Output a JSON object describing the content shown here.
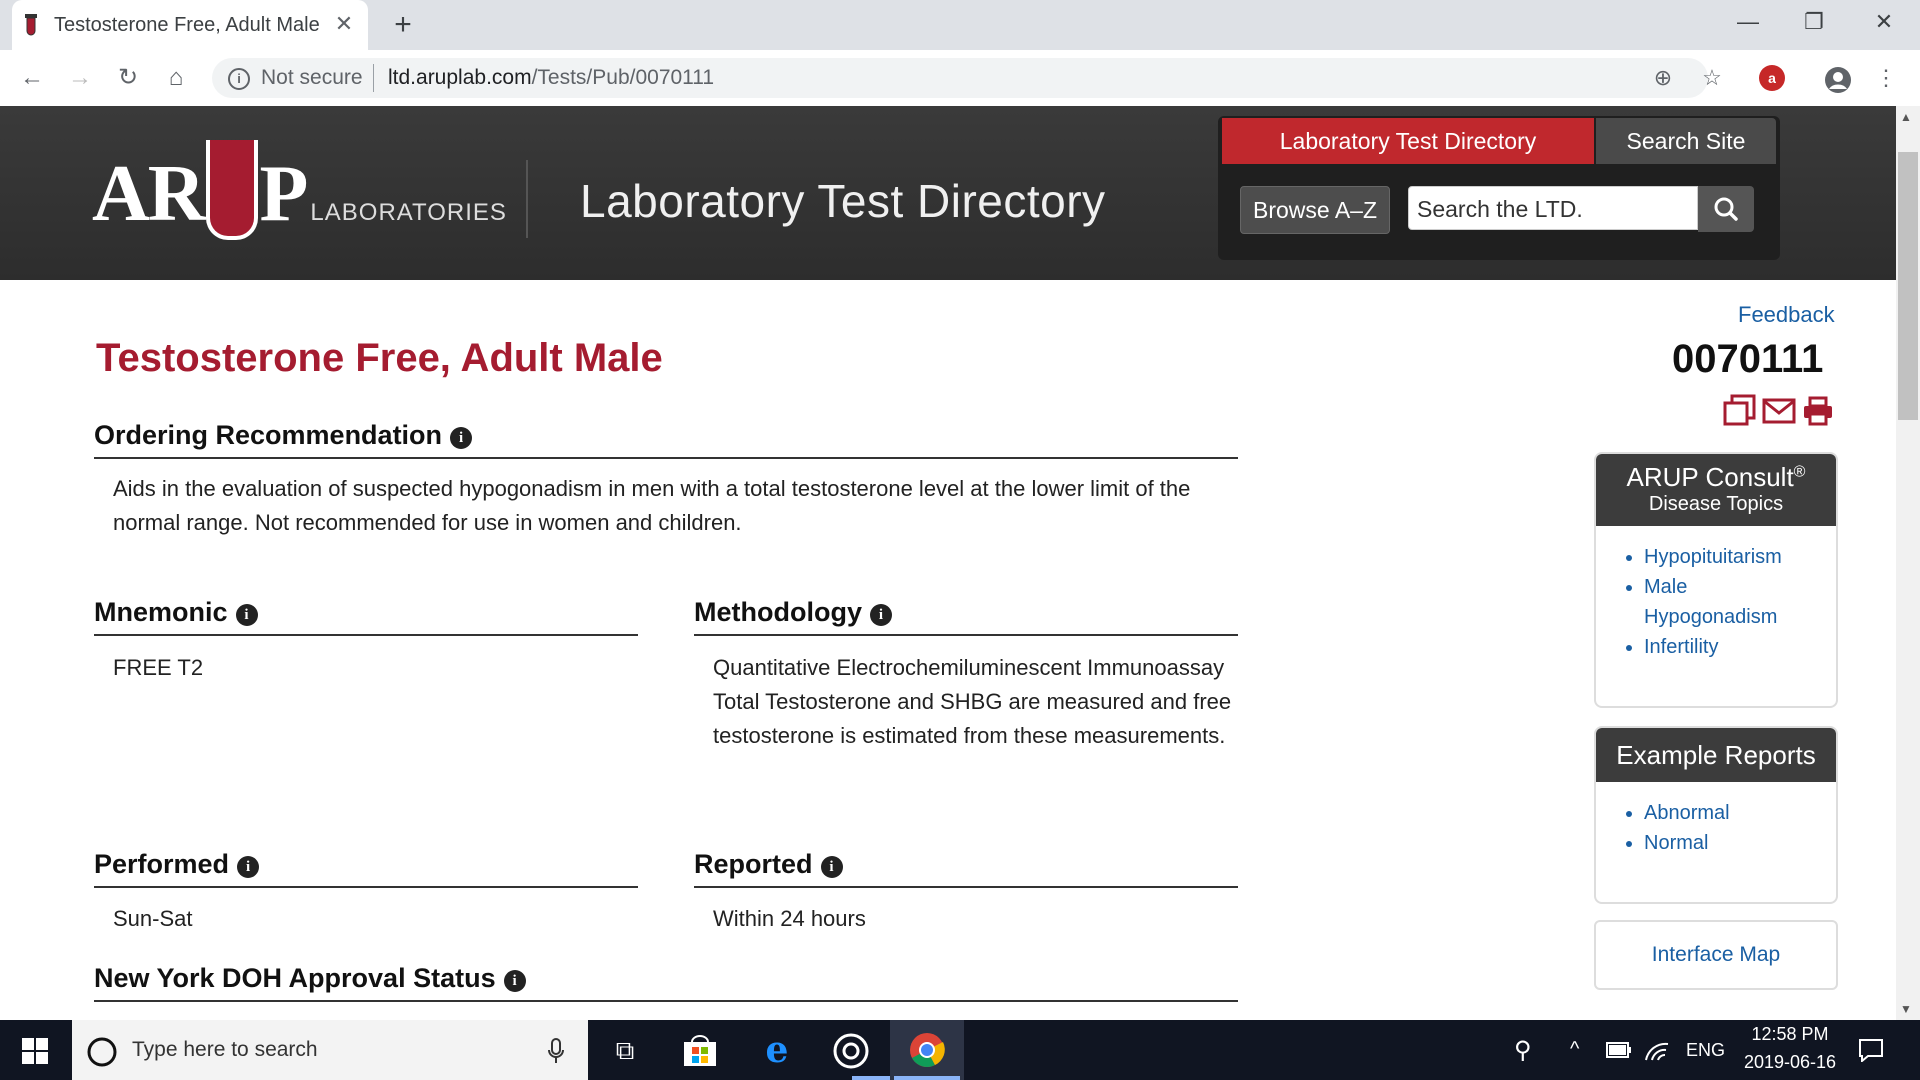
{
  "browser": {
    "tab_title": "Testosterone Free, Adult Male",
    "security_label": "Not secure",
    "url_host": "ltd.aruplab.com",
    "url_path": "/Tests/Pub/0070111"
  },
  "header": {
    "logo_main_left": "AR",
    "logo_main_right": "P",
    "logo_sub": "LABORATORIES",
    "site_title": "Laboratory Test Directory",
    "tab_active": "Laboratory Test Directory",
    "tab_inactive": "Search Site",
    "browse_label": "Browse A–Z",
    "search_placeholder": "Search the LTD."
  },
  "main": {
    "feedback": "Feedback",
    "title": "Testosterone Free, Adult Male",
    "test_code": "0070111",
    "ordering_heading": "Ordering Recommendation",
    "ordering_text": "Aids in the evaluation of suspected hypogonadism in men with a total testosterone level at the lower limit of the normal range. Not recommended for use in women and children.",
    "mnemonic_heading": "Mnemonic",
    "mnemonic_value": "FREE T2",
    "methodology_heading": "Methodology",
    "methodology_line1": "Quantitative Electrochemiluminescent Immunoassay",
    "methodology_line2": "Total Testosterone and SHBG are measured and free testosterone is estimated from these measurements.",
    "performed_heading": "Performed",
    "performed_value": "Sun-Sat",
    "reported_heading": "Reported",
    "reported_value": "Within 24 hours",
    "nydoh_heading": "New York DOH Approval Status"
  },
  "sidebar": {
    "consult_title": "ARUP Consult",
    "consult_reg": "®",
    "consult_subtitle": "Disease Topics",
    "consult_items": [
      "Hypopituitarism",
      "Male Hypogonadism",
      "Infertility"
    ],
    "reports_title": "Example Reports",
    "reports_items": [
      "Abnormal",
      "Normal"
    ],
    "interface_map": "Interface Map"
  },
  "taskbar": {
    "search_placeholder": "Type here to search",
    "language": "ENG",
    "time": "12:58 PM",
    "date": "2019-06-16"
  },
  "colors": {
    "brand_red": "#a51c30",
    "link_blue": "#1a5fa3",
    "header_dark": "#2d2d2d"
  }
}
